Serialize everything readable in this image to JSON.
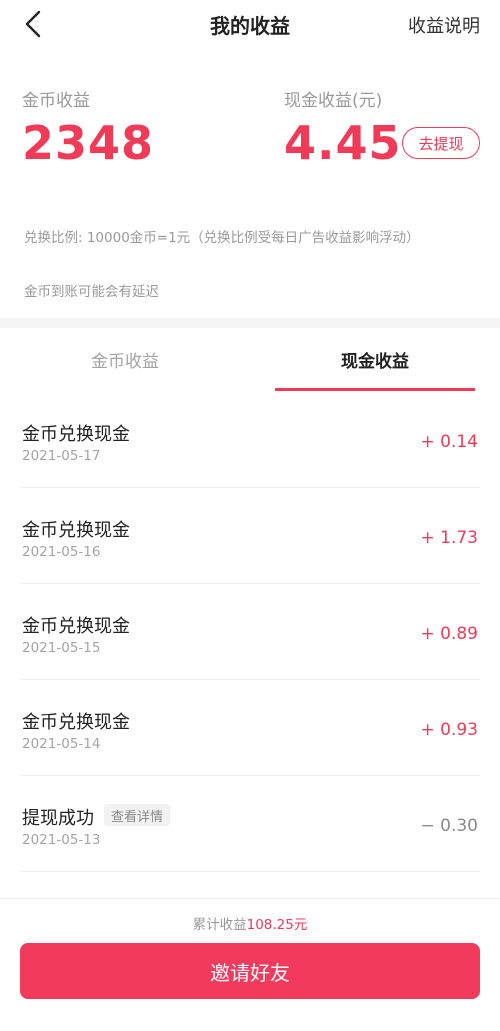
{
  "header": {
    "title": "我的收益",
    "right_link": "收益说明",
    "back_icon": "chevron-left-icon"
  },
  "summary": {
    "coin_label": "金币收益",
    "coin_value": "2348",
    "cash_label": "现金收益(元)",
    "cash_value": "4.45",
    "withdraw_label": "去提现",
    "note_rate": "兑换比例: 10000金币=1元（兑换比例受每日广告收益影响浮动）",
    "note_delay": "金币到账可能会有延迟"
  },
  "tabs": [
    {
      "label": "金币收益",
      "active": false
    },
    {
      "label": "现金收益",
      "active": true
    }
  ],
  "records": [
    {
      "title": "金币兑换现金",
      "date": "2021-05-17",
      "amount": "+ 0.14",
      "type": "plus"
    },
    {
      "title": "金币兑换现金",
      "date": "2021-05-16",
      "amount": "+ 1.73",
      "type": "plus"
    },
    {
      "title": "金币兑换现金",
      "date": "2021-05-15",
      "amount": "+ 0.89",
      "type": "plus"
    },
    {
      "title": "金币兑换现金",
      "date": "2021-05-14",
      "amount": "+ 0.93",
      "type": "plus"
    },
    {
      "title": "提现成功",
      "date": "2021-05-13",
      "amount": "− 0.30",
      "type": "minus",
      "tag": "查看详情"
    }
  ],
  "footer": {
    "total_label": "累计收益",
    "total_value": "108.25元",
    "invite_label": "邀请好友"
  },
  "colors": {
    "accent": "#f03b58",
    "muted": "#999999"
  }
}
